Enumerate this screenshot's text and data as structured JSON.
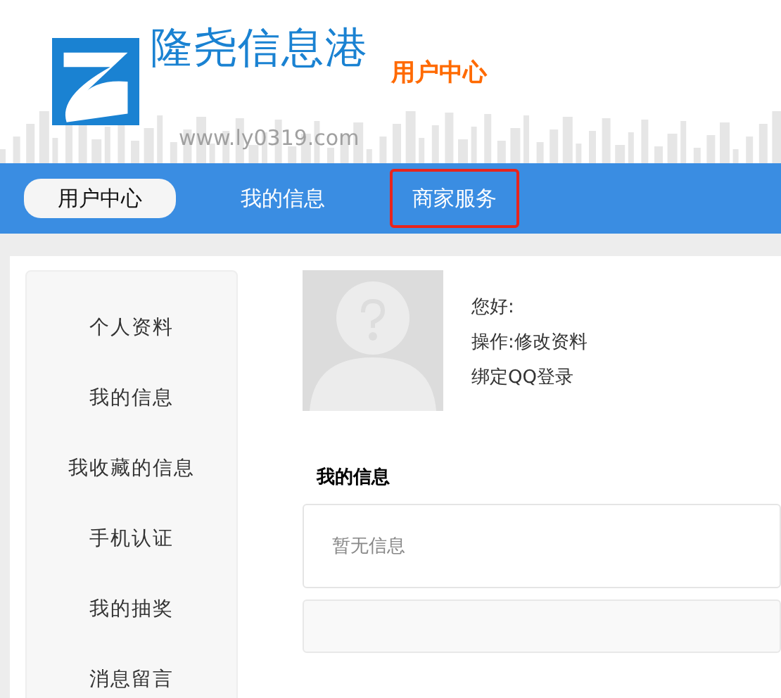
{
  "header": {
    "site_name": "隆尧信息港",
    "section": "用户中心",
    "url": "www.ly0319.com"
  },
  "nav": [
    {
      "label": "用户中心",
      "selected": true,
      "highlighted": false
    },
    {
      "label": "我的信息",
      "selected": false,
      "highlighted": false
    },
    {
      "label": "商家服务",
      "selected": false,
      "highlighted": true
    }
  ],
  "sidebar": {
    "items": [
      "个人资料",
      "我的信息",
      "我收藏的信息",
      "手机认证",
      "我的抽奖",
      "消息留言"
    ]
  },
  "profile": {
    "greeting": "您好:",
    "action_label": "操作:",
    "action_link": "修改资料",
    "bind_link": "绑定QQ登录"
  },
  "my_info": {
    "title": "我的信息",
    "empty_text": "暂无信息"
  }
}
